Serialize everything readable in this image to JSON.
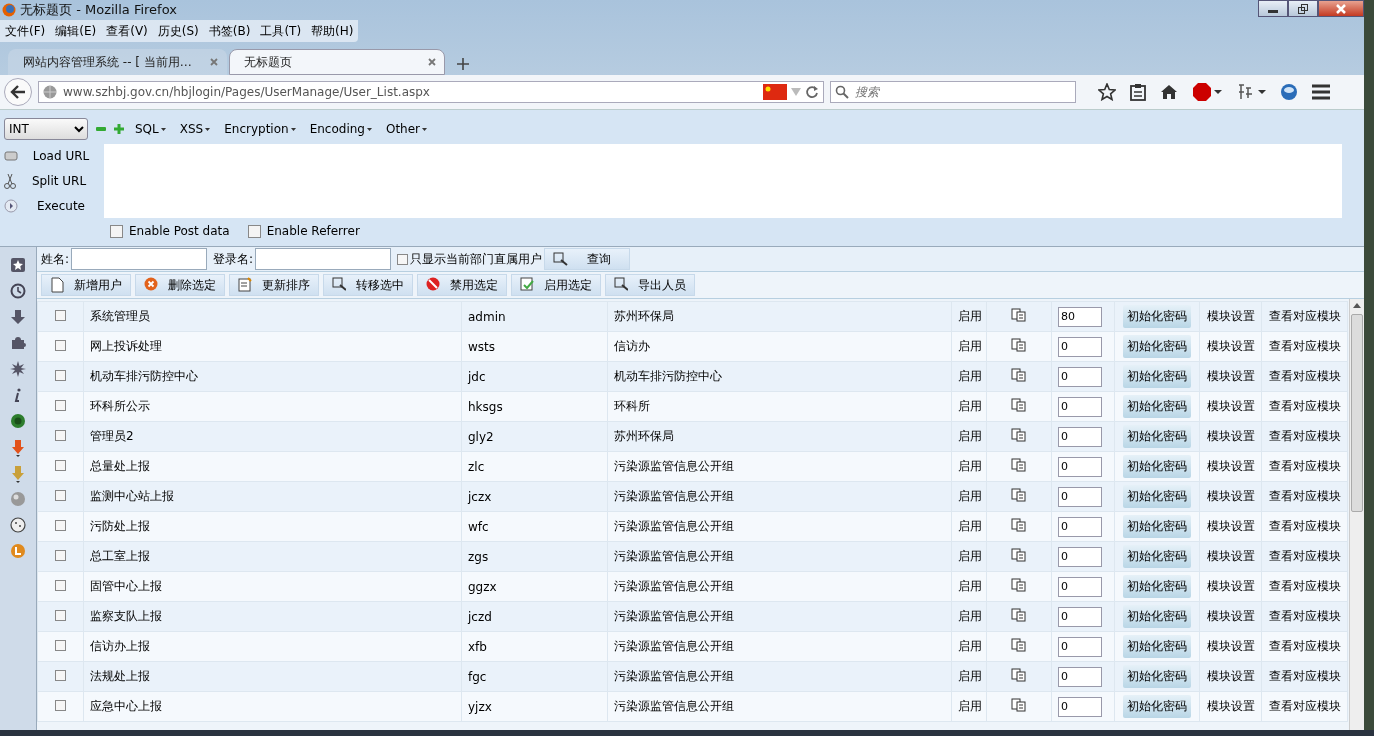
{
  "window": {
    "title": "无标题页 - Mozilla Firefox"
  },
  "menu": [
    "文件(F)",
    "编辑(E)",
    "查看(V)",
    "历史(S)",
    "书签(B)",
    "工具(T)",
    "帮助(H)"
  ],
  "tabs": [
    {
      "label": "网站内容管理系统 -- [ 当前用…",
      "selected": false
    },
    {
      "label": "无标题页",
      "selected": true
    }
  ],
  "address": {
    "value": "www.szhbj.gov.cn/hbjlogin/Pages/UserManage/User_List.aspx"
  },
  "search": {
    "placeholder": "搜索"
  },
  "hackbar": {
    "type_select": "INT",
    "menus": [
      "SQL",
      "XSS",
      "Encryption",
      "Encoding",
      "Other"
    ],
    "actions": [
      "Load URL",
      "Split URL",
      "Execute"
    ],
    "options": [
      {
        "label": "Enable Post data",
        "checked": false
      },
      {
        "label": "Enable Referrer",
        "checked": false
      }
    ]
  },
  "filter": {
    "name_label": "姓名:",
    "login_label": "登录名:",
    "direct_only": {
      "label": "只显示当前部门直属用户",
      "checked": false
    },
    "query_button": "查询"
  },
  "toolbar": [
    "新增用户",
    "删除选定",
    "更新排序",
    "转移选中",
    "禁用选定",
    "启用选定",
    "导出人员"
  ],
  "rows": [
    {
      "name": "系统管理员",
      "login": "admin",
      "dept": "苏州环保局",
      "status": "启用",
      "order": "80",
      "reset": "初始化密码",
      "module": "模块设置",
      "view": "查看对应模块",
      "checked": false
    },
    {
      "name": "网上投诉处理",
      "login": "wsts",
      "dept": "信访办",
      "status": "启用",
      "order": "0",
      "reset": "初始化密码",
      "module": "模块设置",
      "view": "查看对应模块",
      "checked": false
    },
    {
      "name": "机动车排污防控中心",
      "login": "jdc",
      "dept": "机动车排污防控中心",
      "status": "启用",
      "order": "0",
      "reset": "初始化密码",
      "module": "模块设置",
      "view": "查看对应模块",
      "checked": false
    },
    {
      "name": "环科所公示",
      "login": "hksgs",
      "dept": "环科所",
      "status": "启用",
      "order": "0",
      "reset": "初始化密码",
      "module": "模块设置",
      "view": "查看对应模块",
      "checked": false
    },
    {
      "name": "管理员2",
      "login": "gly2",
      "dept": "苏州环保局",
      "status": "启用",
      "order": "0",
      "reset": "初始化密码",
      "module": "模块设置",
      "view": "查看对应模块",
      "checked": false
    },
    {
      "name": "总量处上报",
      "login": "zlc",
      "dept": "污染源监管信息公开组",
      "status": "启用",
      "order": "0",
      "reset": "初始化密码",
      "module": "模块设置",
      "view": "查看对应模块",
      "checked": false
    },
    {
      "name": "监测中心站上报",
      "login": "jczx",
      "dept": "污染源监管信息公开组",
      "status": "启用",
      "order": "0",
      "reset": "初始化密码",
      "module": "模块设置",
      "view": "查看对应模块",
      "checked": false
    },
    {
      "name": "污防处上报",
      "login": "wfc",
      "dept": "污染源监管信息公开组",
      "status": "启用",
      "order": "0",
      "reset": "初始化密码",
      "module": "模块设置",
      "view": "查看对应模块",
      "checked": false
    },
    {
      "name": "总工室上报",
      "login": "zgs",
      "dept": "污染源监管信息公开组",
      "status": "启用",
      "order": "0",
      "reset": "初始化密码",
      "module": "模块设置",
      "view": "查看对应模块",
      "checked": false
    },
    {
      "name": "固管中心上报",
      "login": "ggzx",
      "dept": "污染源监管信息公开组",
      "status": "启用",
      "order": "0",
      "reset": "初始化密码",
      "module": "模块设置",
      "view": "查看对应模块",
      "checked": false
    },
    {
      "name": "监察支队上报",
      "login": "jczd",
      "dept": "污染源监管信息公开组",
      "status": "启用",
      "order": "0",
      "reset": "初始化密码",
      "module": "模块设置",
      "view": "查看对应模块",
      "checked": false
    },
    {
      "name": "信访办上报",
      "login": "xfb",
      "dept": "污染源监管信息公开组",
      "status": "启用",
      "order": "0",
      "reset": "初始化密码",
      "module": "模块设置",
      "view": "查看对应模块",
      "checked": false
    },
    {
      "name": "法规处上报",
      "login": "fgc",
      "dept": "污染源监管信息公开组",
      "status": "启用",
      "order": "0",
      "reset": "初始化密码",
      "module": "模块设置",
      "view": "查看对应模块",
      "checked": false
    },
    {
      "name": "应急中心上报",
      "login": "yjzx",
      "dept": "污染源监管信息公开组",
      "status": "启用",
      "order": "0",
      "reset": "初始化密码",
      "module": "模块设置",
      "view": "查看对应模块",
      "checked": false
    }
  ]
}
